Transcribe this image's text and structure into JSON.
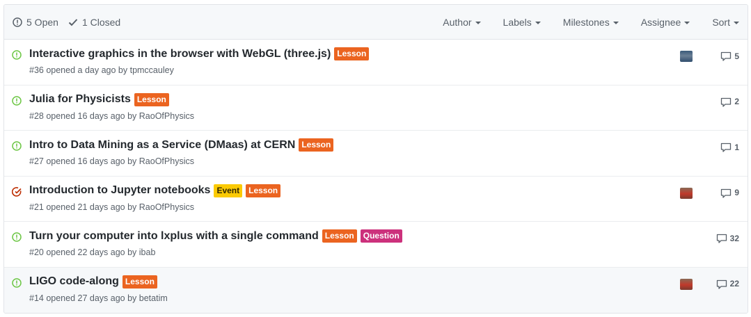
{
  "header": {
    "open_label": "5 Open",
    "closed_label": "1 Closed",
    "filters": [
      "Author",
      "Labels",
      "Milestones",
      "Assignee",
      "Sort"
    ]
  },
  "colors": {
    "open": "#6cc644",
    "closed": "#bd2c00",
    "lesson": "#eb6420",
    "event": "#fbca04",
    "question": "#cc317c"
  },
  "issues": [
    {
      "title": "Interactive graphics in the browser with WebGL (three.js)",
      "meta": "#36 opened a day ago by",
      "author": "tpmccauley",
      "state": "open",
      "labels": [
        {
          "text": "Lesson",
          "kind": "lesson"
        }
      ],
      "assignee_avatar": "avatar-blue",
      "comments": "5"
    },
    {
      "title": "Julia for Physicists",
      "meta": "#28 opened 16 days ago by",
      "author": "RaoOfPhysics",
      "state": "open",
      "labels": [
        {
          "text": "Lesson",
          "kind": "lesson"
        }
      ],
      "assignee_avatar": "",
      "comments": "2"
    },
    {
      "title": "Intro to Data Mining as a Service (DMaas) at CERN",
      "meta": "#27 opened 16 days ago by",
      "author": "RaoOfPhysics",
      "state": "open",
      "labels": [
        {
          "text": "Lesson",
          "kind": "lesson"
        }
      ],
      "assignee_avatar": "",
      "comments": "1"
    },
    {
      "title": "Introduction to Jupyter notebooks",
      "meta": "#21 opened 21 days ago by",
      "author": "RaoOfPhysics",
      "state": "in-progress",
      "labels": [
        {
          "text": "Event",
          "kind": "event"
        },
        {
          "text": "Lesson",
          "kind": "lesson"
        }
      ],
      "assignee_avatar": "avatar-red",
      "comments": "9"
    },
    {
      "title": "Turn your computer into lxplus with a single command",
      "meta": "#20 opened 22 days ago by",
      "author": "ibab",
      "state": "open",
      "labels": [
        {
          "text": "Lesson",
          "kind": "lesson"
        },
        {
          "text": "Question",
          "kind": "question"
        }
      ],
      "assignee_avatar": "",
      "comments": "32"
    },
    {
      "title": "LIGO code-along",
      "meta": "#14 opened 27 days ago by",
      "author": "betatim",
      "state": "open",
      "labels": [
        {
          "text": "Lesson",
          "kind": "lesson"
        }
      ],
      "assignee_avatar": "avatar-red",
      "comments": "22"
    }
  ]
}
